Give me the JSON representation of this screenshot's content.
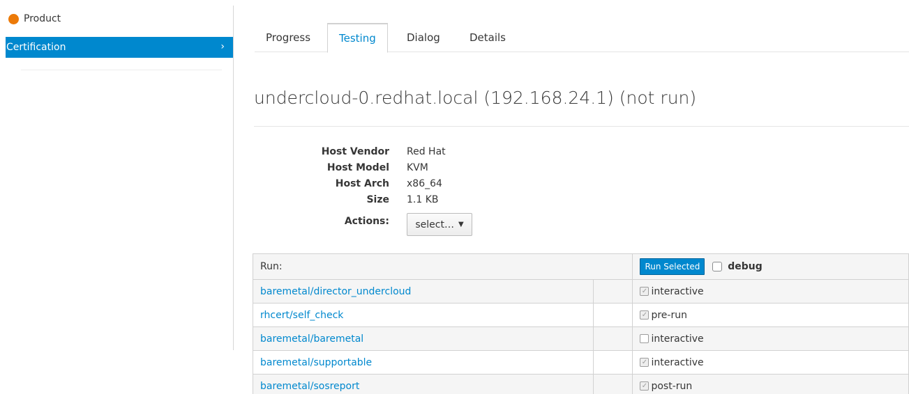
{
  "sidebar": {
    "product_label": "Product",
    "certification_label": "Certification",
    "chevron": "›"
  },
  "tabs": [
    {
      "label": "Progress"
    },
    {
      "label": "Testing"
    },
    {
      "label": "Dialog"
    },
    {
      "label": "Details"
    }
  ],
  "active_tab": "Testing",
  "host": {
    "title": "undercloud-0.redhat.local (192.168.24.1) (not run)",
    "vendor_label": "Host Vendor",
    "vendor": "Red Hat",
    "model_label": "Host Model",
    "model": "KVM",
    "arch_label": "Host Arch",
    "arch": "x86_64",
    "size_label": "Size",
    "size": "1.1 KB",
    "actions_label": "Actions:",
    "actions_select": "select…"
  },
  "table": {
    "run_header": "Run:",
    "run_selected_label": "Run Selected",
    "debug_label": "debug",
    "rows": [
      {
        "name": "baremetal/director_undercloud",
        "option": "interactive",
        "checked": true
      },
      {
        "name": "rhcert/self_check",
        "option": "pre-run",
        "checked": true
      },
      {
        "name": "baremetal/baremetal",
        "option": "interactive",
        "checked": false
      },
      {
        "name": "baremetal/supportable",
        "option": "interactive",
        "checked": true
      },
      {
        "name": "baremetal/sosreport",
        "option": "post-run",
        "checked": true
      }
    ]
  },
  "colors": {
    "accent": "#0088ce",
    "product_dot": "#ec7a08"
  }
}
